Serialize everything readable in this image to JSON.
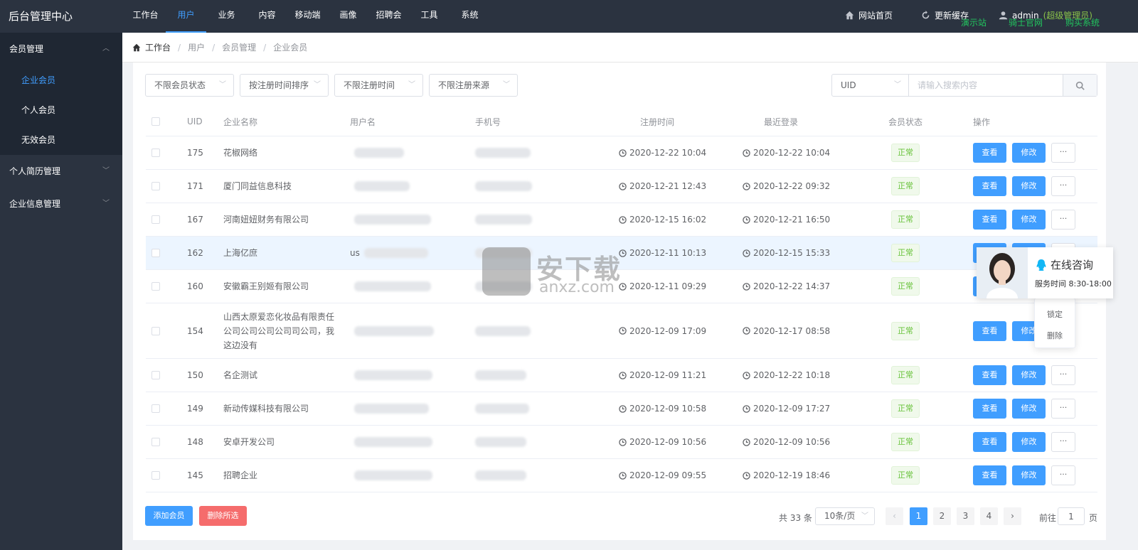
{
  "app": {
    "title": "后台管理中心"
  },
  "topnav": [
    {
      "label": "工作台",
      "active": false
    },
    {
      "label": "用户",
      "active": true
    },
    {
      "label": "业务",
      "active": false
    },
    {
      "label": "内容",
      "active": false
    },
    {
      "label": "移动端",
      "active": false
    },
    {
      "label": "画像",
      "active": false
    },
    {
      "label": "招聘会",
      "active": false
    },
    {
      "label": "工具",
      "active": false
    },
    {
      "label": "系统",
      "active": false
    }
  ],
  "topright": {
    "home": "网站首页",
    "refresh": "更新缓存",
    "user": "admin",
    "role": "(超级管理员)",
    "links": [
      "演示站",
      "骑士官网",
      "购买系统"
    ]
  },
  "sidebar": {
    "groups": [
      {
        "label": "会员管理",
        "open": true,
        "items": [
          {
            "label": "企业会员",
            "active": true
          },
          {
            "label": "个人会员",
            "active": false
          },
          {
            "label": "无效会员",
            "active": false
          }
        ]
      },
      {
        "label": "个人简历管理",
        "open": false
      },
      {
        "label": "企业信息管理",
        "open": false
      }
    ]
  },
  "breadcrumb": [
    "工作台",
    "用户",
    "会员管理",
    "企业会员"
  ],
  "filters": [
    "不限会员状态",
    "按注册时间排序",
    "不限注册时间",
    "不限注册来源"
  ],
  "search": {
    "field": "UID",
    "placeholder": "请输入搜索内容",
    "value": ""
  },
  "table": {
    "columns": [
      "UID",
      "企业名称",
      "用户名",
      "手机号",
      "注册时间",
      "最近登录",
      "会员状态",
      "操作"
    ],
    "rows": [
      {
        "uid": "175",
        "name": "花椒网络",
        "reg": "2020-12-22 10:04",
        "login": "2020-12-22 10:04",
        "status": "正常",
        "username_prefix": ""
      },
      {
        "uid": "171",
        "name": "厦门同益信息科技",
        "reg": "2020-12-21 12:43",
        "login": "2020-12-22 09:32",
        "status": "正常",
        "username_prefix": ""
      },
      {
        "uid": "167",
        "name": "河南妞妞财务有限公司",
        "reg": "2020-12-15 16:02",
        "login": "2020-12-21 16:50",
        "status": "正常",
        "username_prefix": ""
      },
      {
        "uid": "162",
        "name": "上海亿庶",
        "reg": "2020-12-11 10:13",
        "login": "2020-12-15 15:33",
        "status": "正常",
        "username_prefix": "us"
      },
      {
        "uid": "160",
        "name": "安徽霸王别姬有限公司",
        "reg": "2020-12-11 09:29",
        "login": "2020-12-22 14:37",
        "status": "正常",
        "username_prefix": ""
      },
      {
        "uid": "154",
        "name": "山西太原爱恋化妆品有限责任公司公司公司公司司公司，我这边没有",
        "reg": "2020-12-09 17:09",
        "login": "2020-12-17 08:58",
        "status": "正常",
        "username_prefix": ""
      },
      {
        "uid": "150",
        "name": "名企测试",
        "reg": "2020-12-09 11:21",
        "login": "2020-12-22 10:18",
        "status": "正常",
        "username_prefix": ""
      },
      {
        "uid": "149",
        "name": "新动传媒科技有限公司",
        "reg": "2020-12-09 10:58",
        "login": "2020-12-09 17:27",
        "status": "正常",
        "username_prefix": ""
      },
      {
        "uid": "148",
        "name": "安卓开发公司",
        "reg": "2020-12-09 10:56",
        "login": "2020-12-09 10:56",
        "status": "正常",
        "username_prefix": ""
      },
      {
        "uid": "145",
        "name": "招聘企业",
        "reg": "2020-12-09 09:55",
        "login": "2020-12-19 18:46",
        "status": "正常",
        "username_prefix": ""
      }
    ],
    "actions": {
      "view": "查看",
      "edit": "修改",
      "more": "···"
    }
  },
  "dropdown": [
    "锁定",
    "删除"
  ],
  "footer": {
    "add": "添加会员",
    "delete_selected": "删除所选",
    "total": "共 33 条",
    "page_size": "10条/页",
    "pages": [
      "1",
      "2",
      "3",
      "4"
    ],
    "current_page": "1",
    "prev": "‹",
    "next": "›",
    "goto_label": "前往",
    "goto_value": "1",
    "goto_unit": "页"
  },
  "consult": {
    "title": "在线咨询",
    "hours": "服务时间 8:30-18:00"
  },
  "watermark": {
    "text": "安下载",
    "sub": "anxz.com"
  },
  "colors": {
    "primary": "#409eff",
    "danger": "#f56c6c",
    "success": "#67c23a",
    "sidebar": "#2b3340"
  },
  "icons": [
    "home-icon",
    "refresh-icon",
    "user-icon",
    "search-icon",
    "clock-icon",
    "qq-icon"
  ]
}
